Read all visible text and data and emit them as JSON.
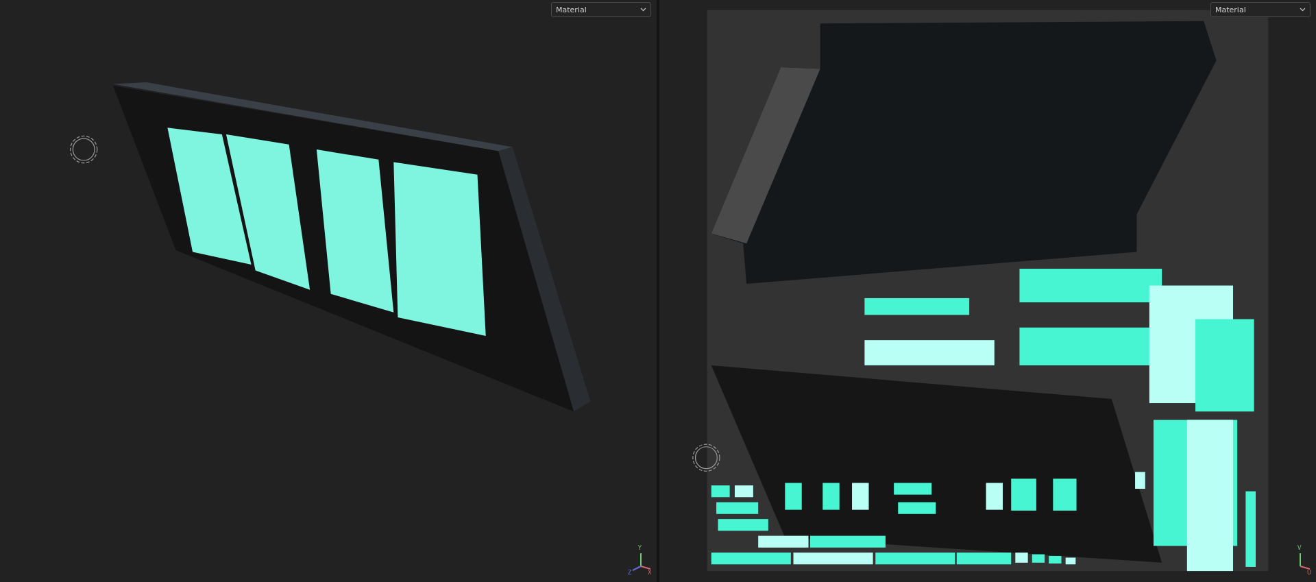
{
  "viewports": [
    {
      "kind": "model",
      "display_mode": "Material",
      "axes": [
        {
          "label": "Y",
          "kind": "y"
        },
        {
          "label": "X",
          "kind": "x"
        },
        {
          "label": "Z",
          "kind": "z"
        }
      ]
    },
    {
      "kind": "uv",
      "display_mode": "Material",
      "axes": [
        {
          "label": "V",
          "kind": "y"
        },
        {
          "label": "U",
          "kind": "x"
        }
      ]
    }
  ]
}
